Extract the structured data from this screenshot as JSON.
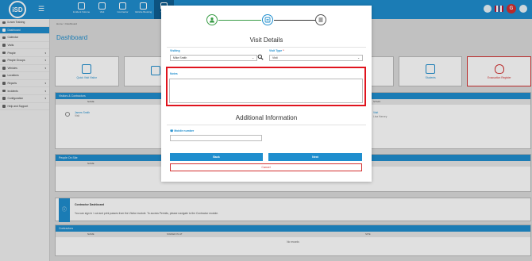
{
  "topbar": {
    "logo_text": "iSD",
    "nav": [
      {
        "label": "Incident Volume"
      },
      {
        "label": "Visit"
      },
      {
        "label": "Contractor"
      },
      {
        "label": "Vehicle Booking"
      },
      {
        "label": "Visitor"
      }
    ],
    "avatar_letter": "G"
  },
  "sidebar": {
    "items": [
      {
        "label": "iLearn Training"
      },
      {
        "label": "Dashboard"
      },
      {
        "label": "Calendar"
      },
      {
        "label": "Visits"
      },
      {
        "label": "People"
      },
      {
        "label": "People Groups"
      },
      {
        "label": "Vehicles"
      },
      {
        "label": "Locations"
      },
      {
        "label": "Reports"
      },
      {
        "label": "Incidents"
      },
      {
        "label": "Configuration"
      },
      {
        "label": "Help and Support"
      }
    ]
  },
  "main": {
    "breadcrumb": "Home  >  Dashboard",
    "title": "Dashboard",
    "tiles": [
      {
        "label": "Quick Visit Visitor"
      },
      {
        "label": ""
      },
      {
        "label": ""
      },
      {
        "label": ""
      },
      {
        "label": ""
      },
      {
        "label": "Students"
      },
      {
        "label": "Evacuation Register"
      }
    ],
    "visitors_panel": {
      "title": "Visitors & Contractors",
      "col": "NAME",
      "col2": "STAFF",
      "row_name": "James Smith",
      "row_sub": "Visit",
      "row_staff": "Visit",
      "row_staff_sub": "Lisa Harvey"
    },
    "people_panel": {
      "title": "People On Site",
      "col": "NAME"
    },
    "info": {
      "title": "Contractor Dashboard",
      "text": "You can sign in / out and print passes from the Visitor module. To access Permits, please navigate to the Contractor module."
    },
    "contractors_panel": {
      "title": "Contractors",
      "col1": "NAME",
      "col2": "SIGNED IN AT",
      "col3": "SITE",
      "empty": "No records"
    }
  },
  "modal": {
    "title": "Visit Details",
    "visiting_label": "Visiting",
    "visiting_value": "Mike Smith",
    "visit_type_label": "Visit Type",
    "visit_type_required": "*",
    "visit_type_value": "Visit",
    "notes_label": "Notes",
    "notes_value": "",
    "section_title": "Additional Information",
    "mobile_label": "Mobile number",
    "mobile_value": "",
    "back_label": "Back",
    "next_label": "Next",
    "cancel_label": "Cancel",
    "steps": [
      "person-icon",
      "visit-details-icon",
      "list-icon"
    ]
  },
  "colors": {
    "primary": "#1f8ece",
    "done": "#3a9d47",
    "highlight": "#e0141e",
    "danger": "#d32f2f"
  }
}
